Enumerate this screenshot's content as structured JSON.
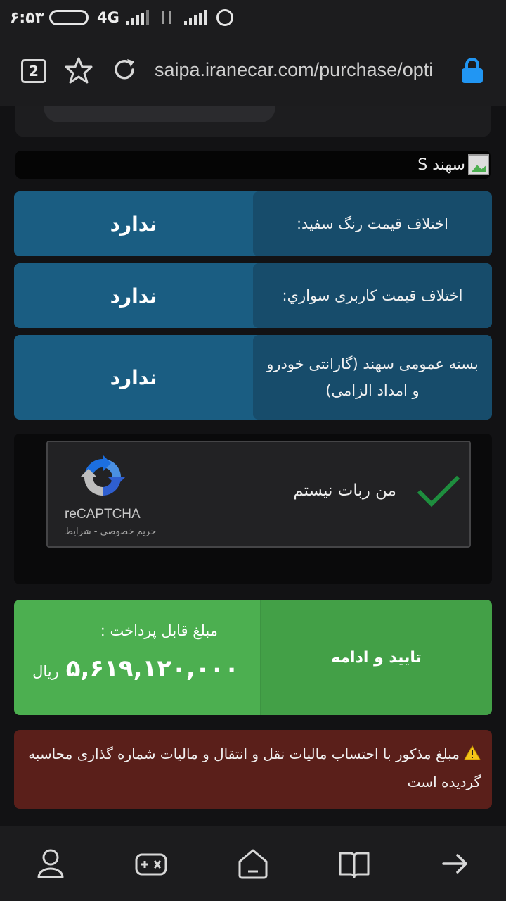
{
  "status_bar": {
    "time": "۶:۵۳",
    "network": "4G"
  },
  "browser": {
    "tab_count": "2",
    "url": "saipa.iranecar.com/purchase/opti",
    "icons": [
      "star-icon",
      "reload-icon",
      "lock-icon"
    ]
  },
  "model": {
    "label": "سهند S"
  },
  "options": [
    {
      "label": "اختلاف قیمت رنگ سفید:",
      "value": "ندارد"
    },
    {
      "label": "اختلاف قیمت کاربری سواري:",
      "value": "ندارد"
    },
    {
      "label": "بسته عمومی سهند (گارانتی خودرو و امداد الزامی)",
      "value": "ندارد"
    }
  ],
  "captcha": {
    "text": "من ربات نیستم",
    "brand": "reCAPTCHA",
    "links": "حریم خصوصی - شرایط",
    "checked": true
  },
  "payment": {
    "title": "مبلغ قابل پرداخت :",
    "amount": "۵,۶۱۹,۱۲۰,۰۰۰",
    "currency": "ریال",
    "button_label": "تایید و ادامه"
  },
  "notice": {
    "text": "مبلغ مذکور با احتساب مالیات نقل و انتقال و مالیات شماره گذاری محاسبه گردیده است"
  },
  "bottom_nav": {
    "icons": [
      "profile-icon",
      "game-icon",
      "home-icon",
      "bookmarks-icon",
      "forward-icon"
    ]
  },
  "colors": {
    "option_bg": "#1a5d82",
    "pay_bg": "#4caf50",
    "notice_bg": "#5a1f1a"
  }
}
